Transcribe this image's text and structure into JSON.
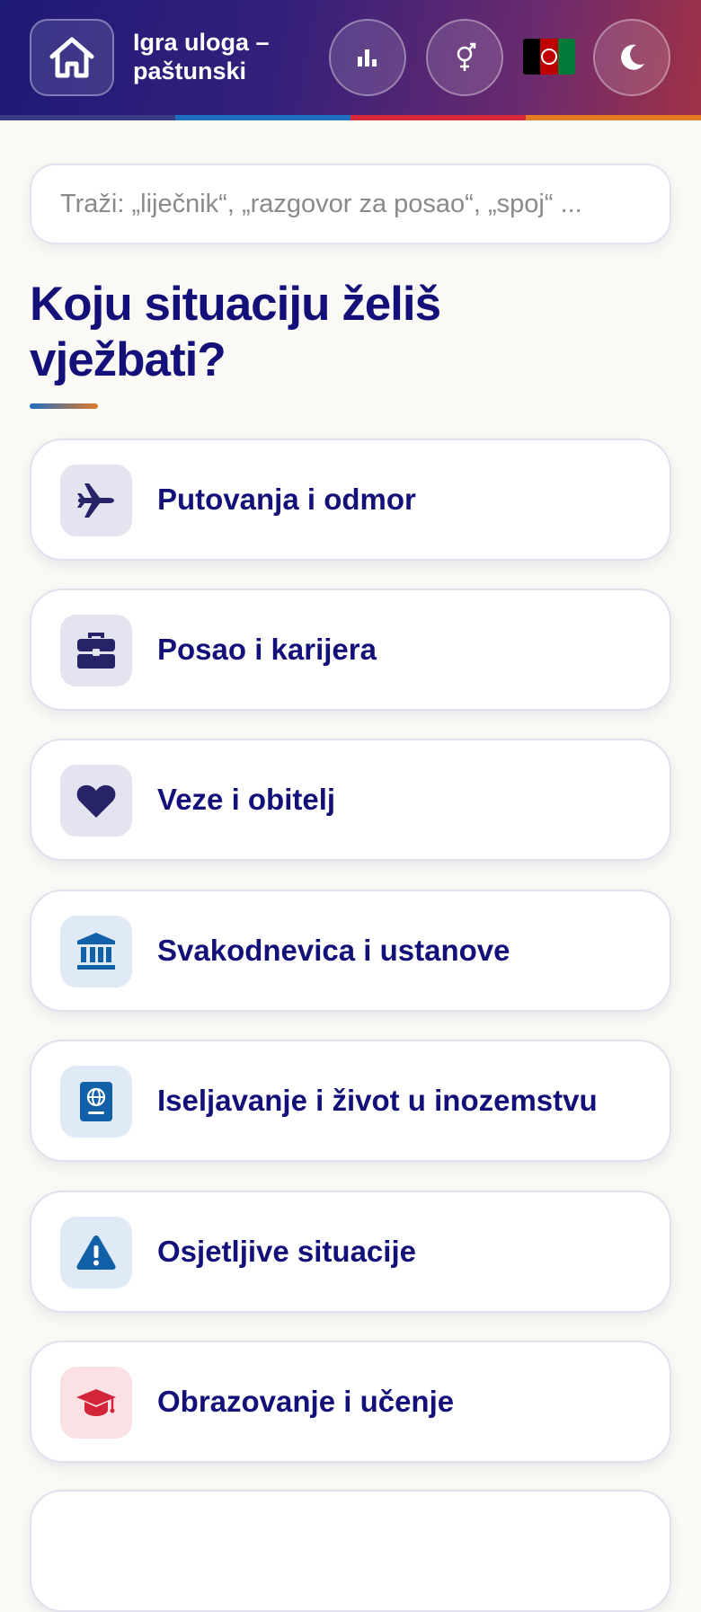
{
  "header": {
    "title": "Igra uloga –\npaštunski",
    "stripe_colors": [
      "#3a3a8a",
      "#1f6fc0",
      "#d8283c",
      "#e67c22"
    ],
    "flag_colors": [
      "#000000",
      "#be0000",
      "#007a36"
    ],
    "icons": {
      "home": "home-icon",
      "stats": "bar-chart-icon",
      "gender": "gender-icon",
      "flag": "afghanistan-flag-icon",
      "theme": "moon-icon"
    }
  },
  "search": {
    "placeholder": "Traži: „liječnik“, „razgovor za posao“, „spoj“ ..."
  },
  "main": {
    "heading": "Koju situaciju želiš vježbati?",
    "categories": [
      {
        "label": "Putovanja i odmor",
        "icon": "airplane-icon",
        "icon_bg": "#e4e3f0",
        "icon_color": "#262466"
      },
      {
        "label": "Posao i karijera",
        "icon": "briefcase-icon",
        "icon_bg": "#e4e3f0",
        "icon_color": "#262466"
      },
      {
        "label": "Veze i obitelj",
        "icon": "heart-icon",
        "icon_bg": "#e4e3f0",
        "icon_color": "#262466"
      },
      {
        "label": "Svakodnevica i ustanove",
        "icon": "bank-building-icon",
        "icon_bg": "#dfeaf6",
        "icon_color": "#1160a8"
      },
      {
        "label": "Iseljavanje i život u inozemstvu",
        "icon": "passport-icon",
        "icon_bg": "#dfeaf6",
        "icon_color": "#1160a8"
      },
      {
        "label": "Osjetljive situacije",
        "icon": "warning-icon",
        "icon_bg": "#dfeaf6",
        "icon_color": "#1160a8"
      },
      {
        "label": "Obrazovanje i učenje",
        "icon": "graduation-cap-icon",
        "icon_bg": "#fbe1e4",
        "icon_color": "#d3243a"
      }
    ]
  }
}
